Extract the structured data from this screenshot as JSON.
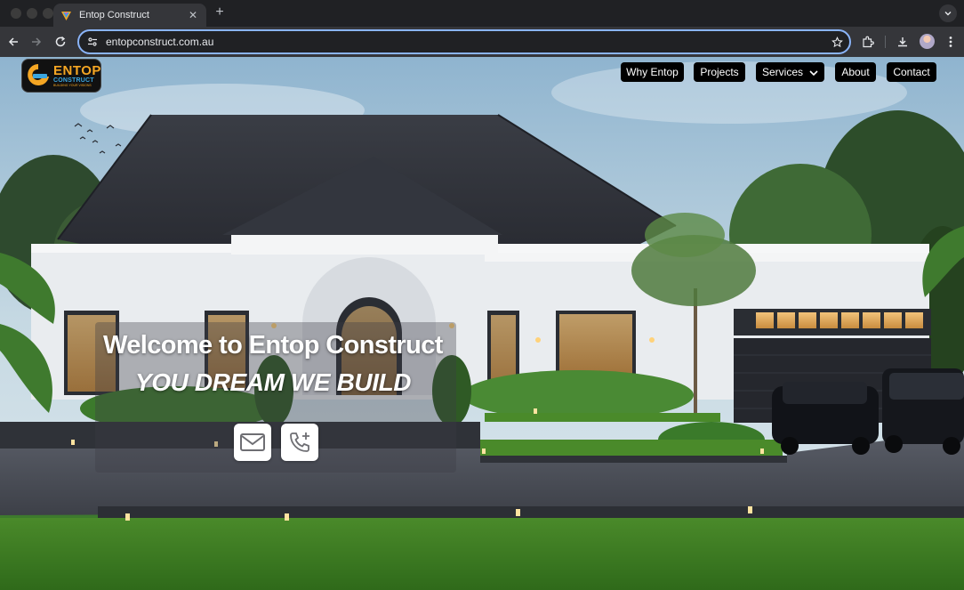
{
  "browser": {
    "tab": {
      "title": "Entop Construct",
      "close_label": "✕"
    },
    "new_tab_label": "+",
    "address": {
      "url": "entopconstruct.com.au"
    }
  },
  "site": {
    "logo": {
      "line1": "ENTOP",
      "line2": "CONSTRUCT",
      "line3": "BUILDING YOUR VISIONS"
    },
    "nav": [
      {
        "label": "Why Entop"
      },
      {
        "label": "Projects"
      },
      {
        "label": "Services"
      },
      {
        "label": "About"
      },
      {
        "label": "Contact"
      }
    ],
    "hero": {
      "title": "Welcome to Entop Construct",
      "tagline": "YOU DREAM WE BUILD"
    },
    "actions": {
      "email_icon": "mail-icon",
      "call_icon": "phone-add-icon"
    }
  },
  "colors": {
    "chrome_dark": "#202124",
    "chrome_toolbar": "#35363a",
    "omnibox_focus": "#8ab4f8",
    "logo_orange": "#f5a623",
    "logo_blue": "#3aa6e0"
  }
}
